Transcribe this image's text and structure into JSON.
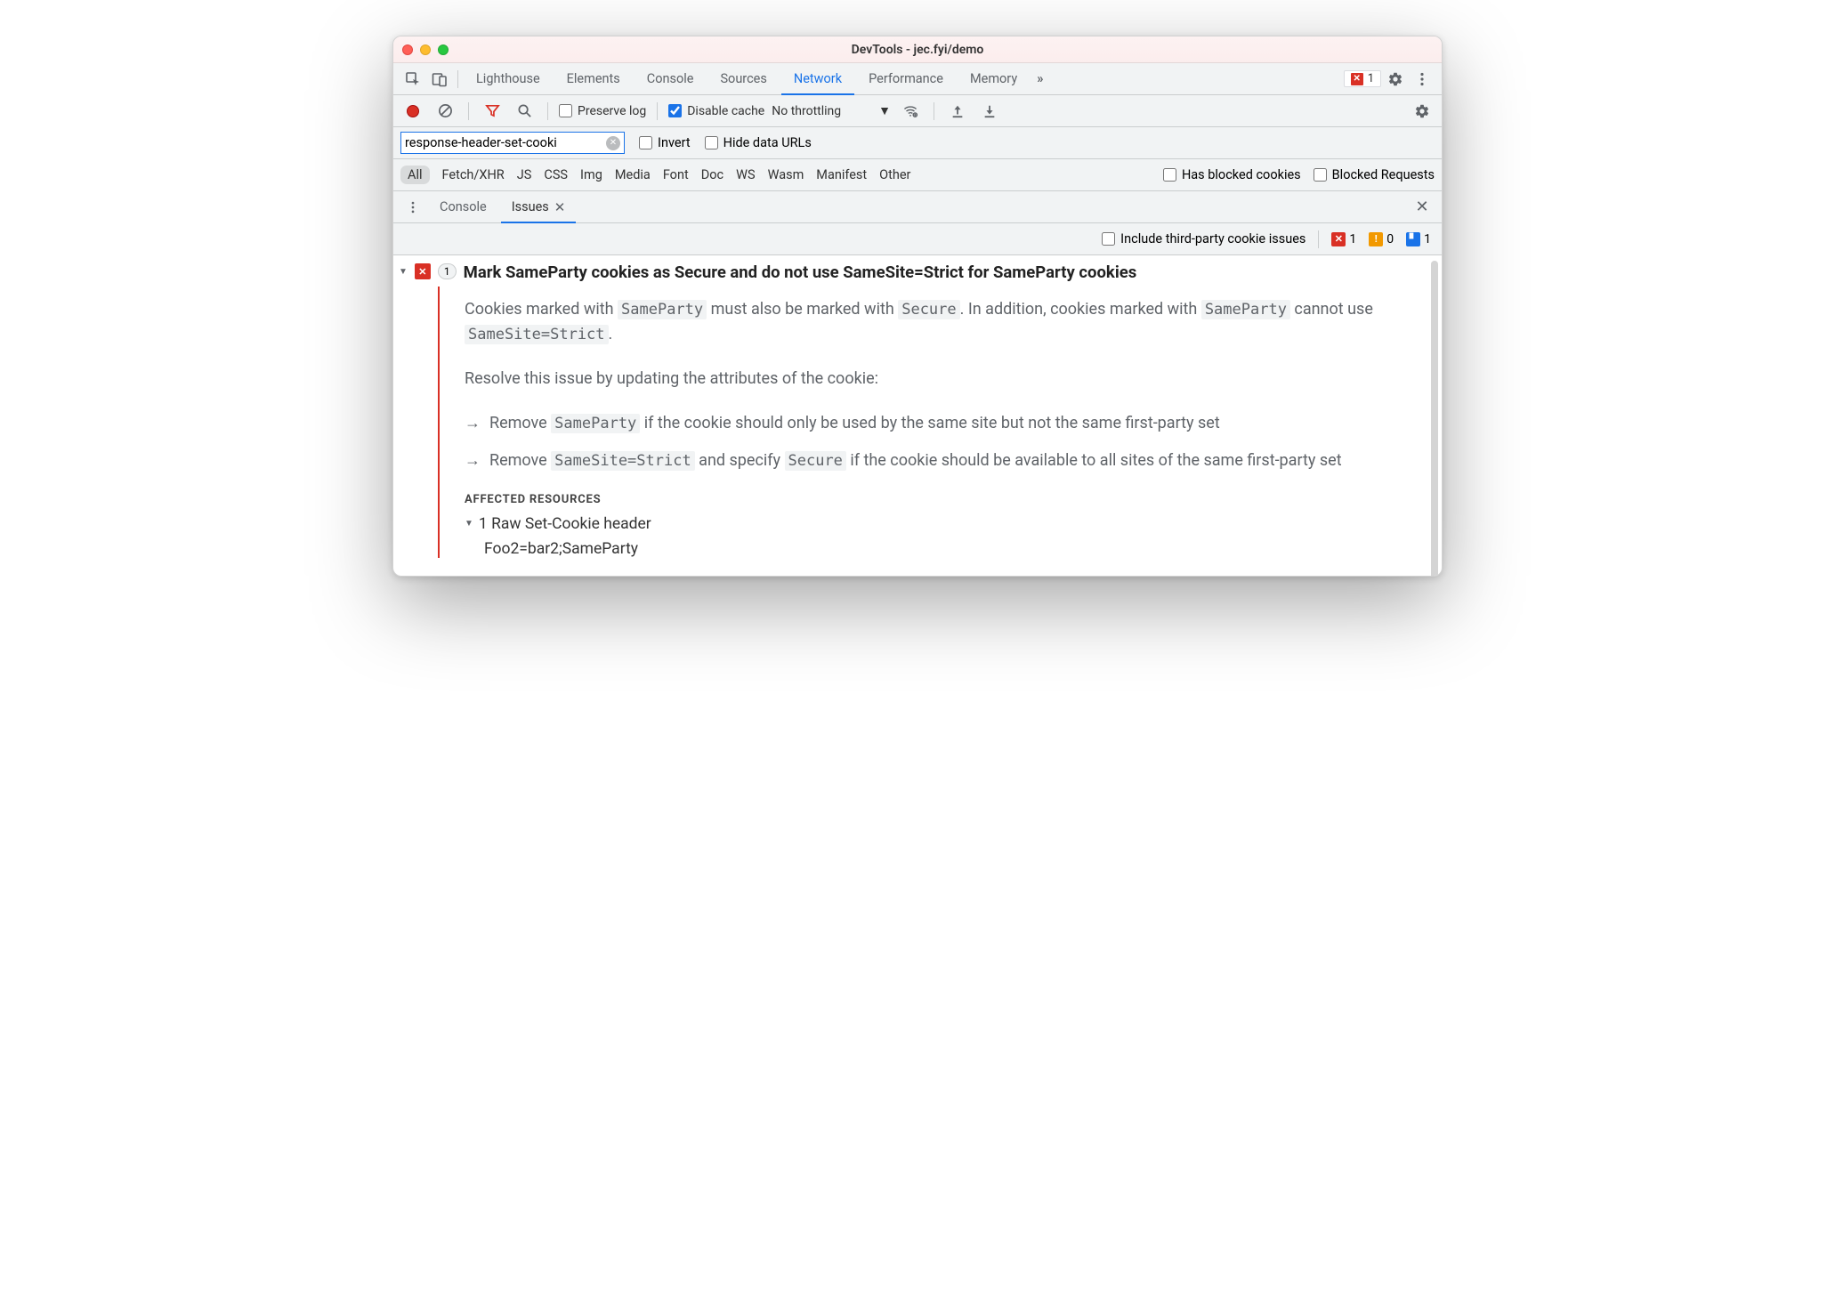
{
  "window": {
    "title": "DevTools - jec.fyi/demo"
  },
  "mainTabs": {
    "items": [
      "Lighthouse",
      "Elements",
      "Console",
      "Sources",
      "Network",
      "Performance",
      "Memory"
    ],
    "active": "Network",
    "overflowLabel": "»",
    "errorBadgeCount": "1"
  },
  "netToolbar": {
    "preserveLog": {
      "label": "Preserve log",
      "checked": false
    },
    "disableCache": {
      "label": "Disable cache",
      "checked": true
    },
    "throttling": "No throttling"
  },
  "filterRow": {
    "filterValue": "response-header-set-cooki",
    "invert": {
      "label": "Invert",
      "checked": false
    },
    "hideDataUrls": {
      "label": "Hide data URLs",
      "checked": false
    }
  },
  "filterCats": {
    "items": [
      "All",
      "Fetch/XHR",
      "JS",
      "CSS",
      "Img",
      "Media",
      "Font",
      "Doc",
      "WS",
      "Wasm",
      "Manifest",
      "Other"
    ],
    "active": "All",
    "hasBlocked": {
      "label": "Has blocked cookies",
      "checked": false
    },
    "blockedReq": {
      "label": "Blocked Requests",
      "checked": false
    }
  },
  "drawer": {
    "tabs": [
      "Console",
      "Issues"
    ],
    "active": "Issues",
    "subbar": {
      "includeThirdParty": {
        "label": "Include third-party cookie issues",
        "checked": false
      },
      "counts": {
        "errors": "1",
        "warnings": "0",
        "info": "1"
      }
    }
  },
  "issue": {
    "count": "1",
    "title": "Mark SameParty cookies as Secure and do not use SameSite=Strict for SameParty cookies",
    "para1_a": "Cookies marked with ",
    "para1_b": " must also be marked with ",
    "para1_c": ". In addition, cookies marked with ",
    "para1_d": " cannot use ",
    "para1_e": ".",
    "kw_sameparty": "SameParty",
    "kw_secure": "Secure",
    "kw_samesite": "SameSite=Strict",
    "para2": "Resolve this issue by updating the attributes of the cookie:",
    "bullet1_a": "Remove ",
    "bullet1_b": " if the cookie should only be used by the same site but not the same first-party set",
    "bullet2_a": "Remove ",
    "bullet2_b": " and specify ",
    "bullet2_c": " if the cookie should be available to all sites of the same first-party set",
    "affectedHead": "AFFECTED RESOURCES",
    "resourceRow": "1 Raw Set-Cookie header",
    "cookieVal": "Foo2=bar2;SameParty"
  }
}
